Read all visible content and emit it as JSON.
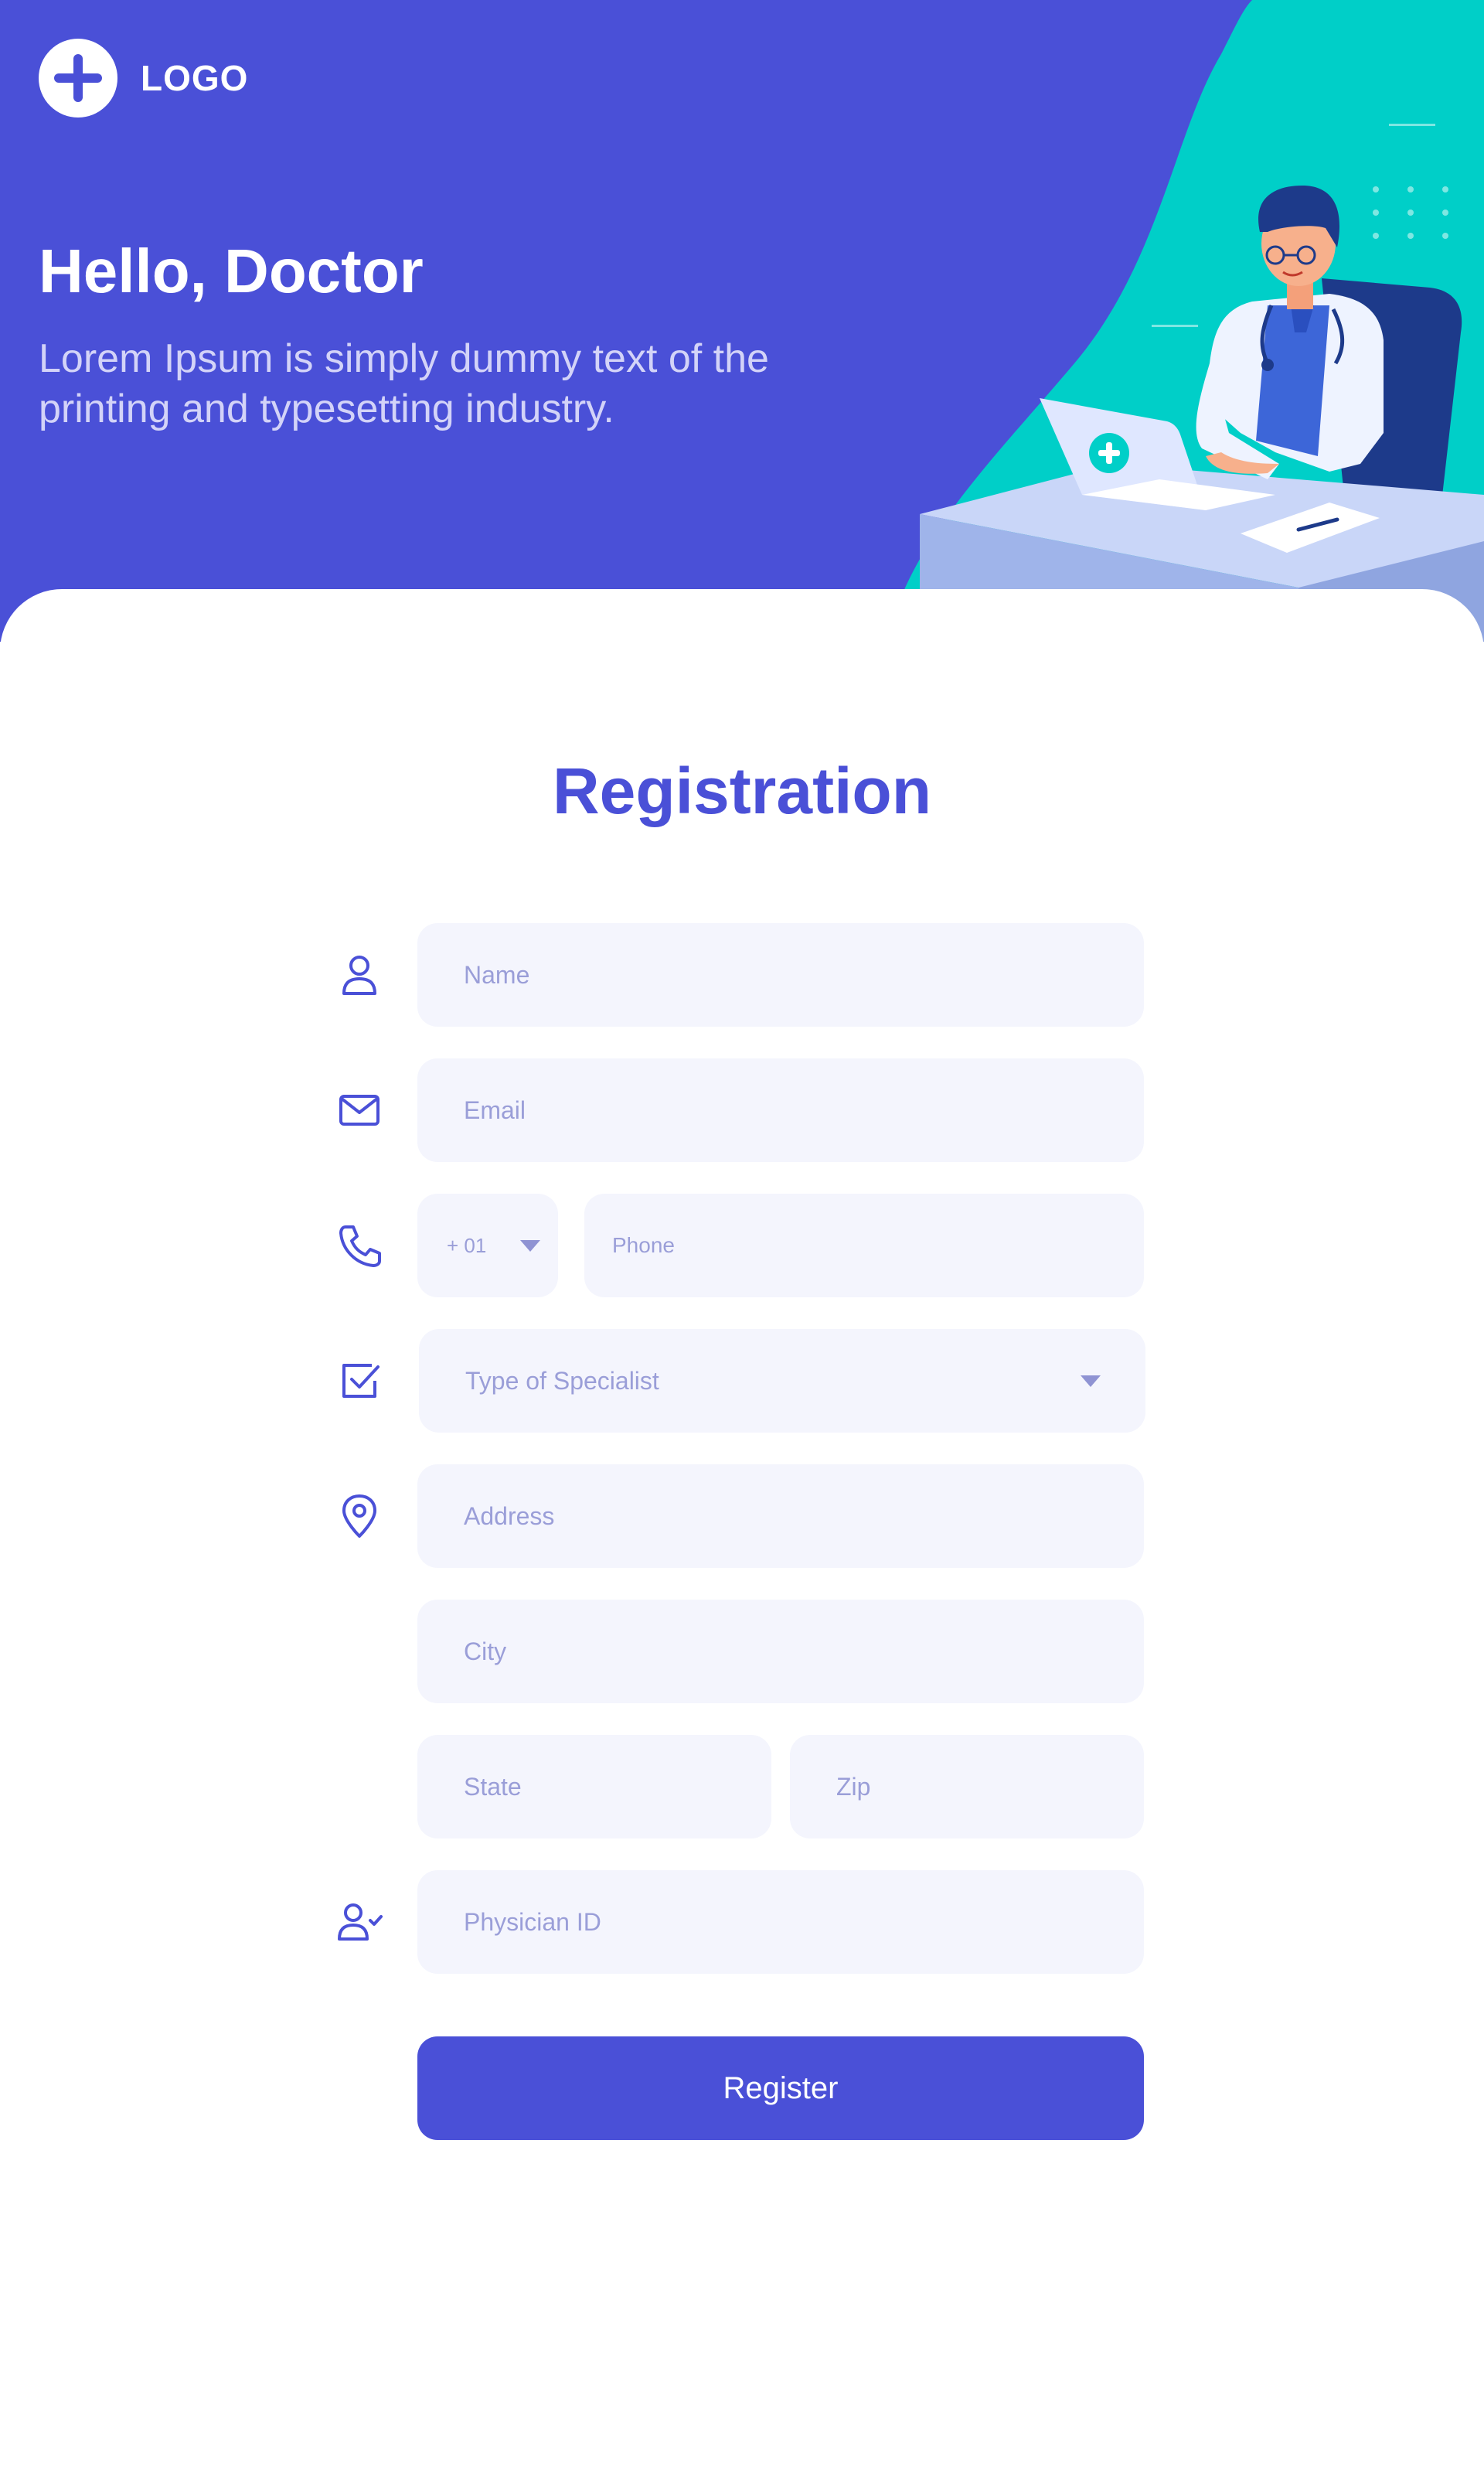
{
  "header": {
    "logo_text": "LOGO",
    "title": "Hello, Doctor",
    "subtitle": "Lorem Ipsum is simply dummy text of the printing and typesetting industry."
  },
  "form": {
    "title": "Registration",
    "name_placeholder": "Name",
    "email_placeholder": "Email",
    "country_code": "+ 01",
    "phone_placeholder": "Phone",
    "specialist_placeholder": "Type of Specialist",
    "address_placeholder": "Address",
    "city_placeholder": "City",
    "state_placeholder": "State",
    "zip_placeholder": "Zip",
    "physician_id_placeholder": "Physician ID",
    "register_label": "Register"
  },
  "icons": {
    "name": "user-icon",
    "email": "envelope-icon",
    "phone": "phone-icon",
    "specialist": "checkbox-icon",
    "address": "map-pin-icon",
    "physician_id": "user-check-icon"
  },
  "colors": {
    "primary": "#4a50d7",
    "accent": "#00cfc8",
    "field_background": "#f4f5fd",
    "placeholder": "#9a9ed8"
  }
}
